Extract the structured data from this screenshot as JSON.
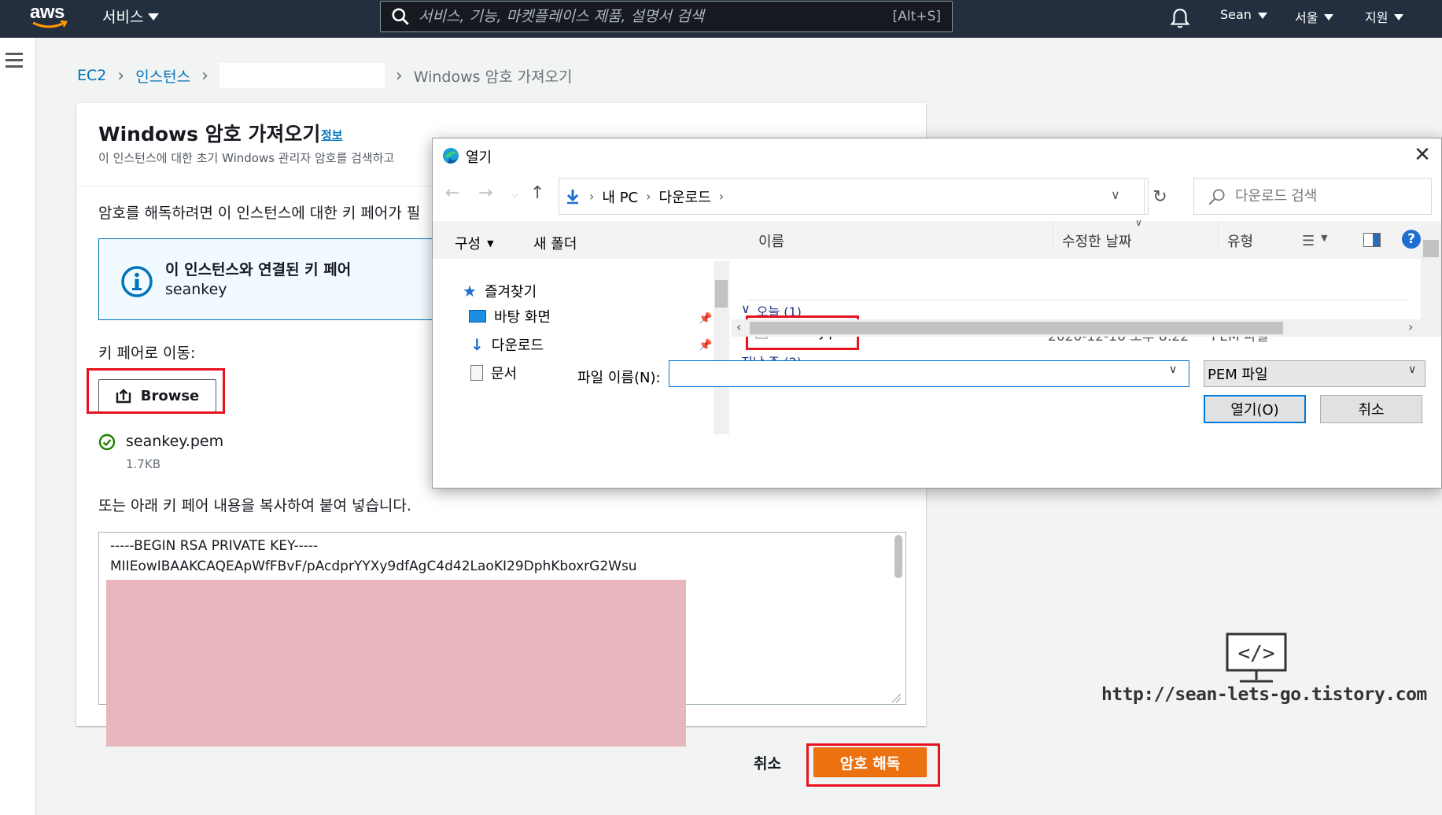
{
  "topnav": {
    "logo_text": "aws",
    "services_label": "서비스",
    "search_placeholder": "서비스, 기능, 마켓플레이스 제품, 설명서 검색",
    "search_shortcut": "[Alt+S]",
    "user_label": "Sean",
    "region_label": "서울",
    "support_label": "지원"
  },
  "breadcrumb": {
    "items": [
      "EC2",
      "인스턴스"
    ],
    "current": "Windows 암호 가져오기"
  },
  "panel": {
    "title": "Windows 암호 가져오기",
    "info_link": "정보",
    "description": "이 인스턴스에 대한 초기 Windows 관리자 암호를 검색하고",
    "decrypt_instruction": "암호를 해독하려면 이 인스턴스에 대한 키 페어가 필",
    "info_box_title": "이 인스턴스와 연결된 키 페어",
    "info_box_value": "seankey",
    "keypair_label": "키 페어로 이동:",
    "browse_label": "Browse",
    "file_name": "seankey.pem",
    "file_size": "1.7KB",
    "paste_label": "또는 아래 키 페어 내용을 복사하여 붙여 넣습니다.",
    "key_line1": "-----BEGIN RSA PRIVATE KEY-----",
    "key_line2": "MIIEowIBAAKCAQEApWfFBvF/pAcdprYYXy9dfAgC4d42LaoKI29DphKboxrG2Wsu",
    "cancel_label": "취소",
    "decrypt_label": "암호 해독"
  },
  "watermark": {
    "url": "http://sean-lets-go.tistory.com"
  },
  "dialog": {
    "title": "열기",
    "close_label": "✕",
    "address": [
      "내 PC",
      "다운로드"
    ],
    "search_placeholder": "다운로드 검색",
    "organize_label": "구성",
    "new_folder_label": "새 폴더",
    "help_label": "?",
    "nav_items": [
      {
        "label": "즐겨찾기"
      },
      {
        "label": "바탕 화면"
      },
      {
        "label": "다운로드"
      },
      {
        "label": "문서"
      }
    ],
    "columns": {
      "name": "이름",
      "modified": "수정한 날짜",
      "type": "유형"
    },
    "group_today": "오늘 (1)",
    "group_past": "지난 주 (2)",
    "file": {
      "name": "seankey.pem",
      "modified": "2020-12-16 오후 8:22",
      "type": "PEM 파일"
    },
    "filename_label": "파일 이름(N):",
    "filename_value": "",
    "filetype_value": "PEM 파일",
    "open_label": "열기(O)",
    "cancel_label": "취소"
  },
  "colors": {
    "aws_nav": "#232f3e",
    "aws_orange": "#ec7211",
    "aws_link": "#0073bb",
    "highlight_red": "#e8121f",
    "redaction_pink": "#e8b7be"
  }
}
